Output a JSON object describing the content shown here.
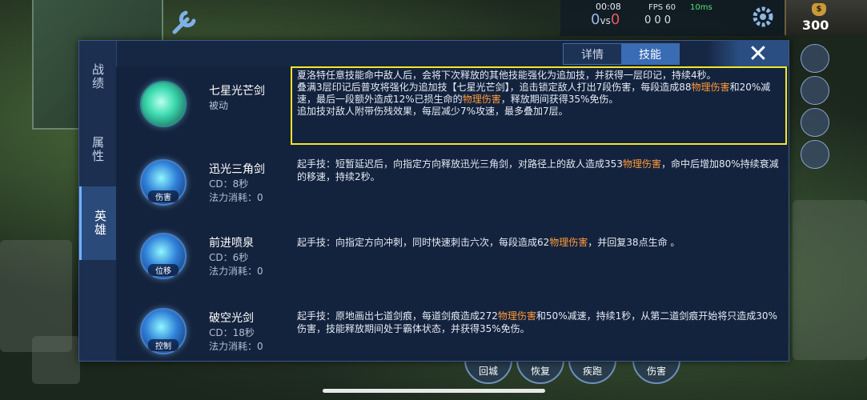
{
  "hud": {
    "timer": "00:08",
    "score_blue": "0",
    "score_vs": "vs",
    "score_red": "0",
    "fps": "FPS 60",
    "ping": "10ms",
    "kda": "0 0 0",
    "gold": "300",
    "gold_icon_label": "$"
  },
  "side_tabs": [
    {
      "label": "战绩"
    },
    {
      "label": "属性"
    },
    {
      "label": "英雄"
    }
  ],
  "top_tabs": [
    {
      "label": "详情"
    },
    {
      "label": "技能"
    }
  ],
  "close_label": "✕",
  "skills": [
    {
      "name": "七星光芒剑",
      "sub1": "被动",
      "desc_parts": [
        {
          "t": "夏洛特任意技能命中敌人后，会将下次释放的其他技能强化为追加技，并获得一层印记，持续4秒。"
        },
        {
          "t": "叠满3层印记后普攻将强化为追加技【七星光芒剑】，追击锁定敌人打出7段伤害，每段造成88"
        },
        {
          "t": "物理伤害",
          "hl": true
        },
        {
          "t": "和20%减速，最后一段额外造成12%已损生命的"
        },
        {
          "t": "物理伤害",
          "hl": true
        },
        {
          "t": "，释放期间获得35%免伤。"
        },
        {
          "t": "追加技对敌人附带伤残效果，每层减少7%攻速，最多叠加7层。"
        }
      ]
    },
    {
      "name": "迅光三角剑",
      "cd": "CD：8秒",
      "cost": "法力消耗：0",
      "tag": "伤害",
      "desc_parts": [
        {
          "t": "起手技：短暂延迟后，向指定方向释放迅光三角剑，对路径上的敌人造成353"
        },
        {
          "t": "物理伤害",
          "hl": true
        },
        {
          "t": "，命中后增加80%持续衰减的移速，持续2秒。"
        }
      ]
    },
    {
      "name": "前进喷泉",
      "cd": "CD：6秒",
      "cost": "法力消耗：0",
      "tag": "位移",
      "desc_parts": [
        {
          "t": "起手技：向指定方向冲刺，同时快速刺击六次，每段造成62"
        },
        {
          "t": "物理伤害",
          "hl": true
        },
        {
          "t": "，并回复38点生命 。"
        }
      ]
    },
    {
      "name": "破空光剑",
      "cd": "CD：18秒",
      "cost": "法力消耗：0",
      "tag": "控制",
      "desc_parts": [
        {
          "t": "起手技：原地画出七道剑痕，每道剑痕造成272"
        },
        {
          "t": "物理伤害",
          "hl": true
        },
        {
          "t": "和50%减速，持续1秒，从第二道剑痕开始将只造成30%伤害，技能释放期间处于霸体状态，并获得35%免伤。"
        }
      ]
    }
  ],
  "bottom_skills": [
    {
      "label": "回城"
    },
    {
      "label": "恢复"
    },
    {
      "label": "疾跑"
    },
    {
      "label": "伤害"
    }
  ],
  "colors": {
    "highlight_box": "#f5e626",
    "damage_text": "#ff9a3c",
    "panel_bg": "#162744",
    "active_tab": "#3a6cb5"
  }
}
